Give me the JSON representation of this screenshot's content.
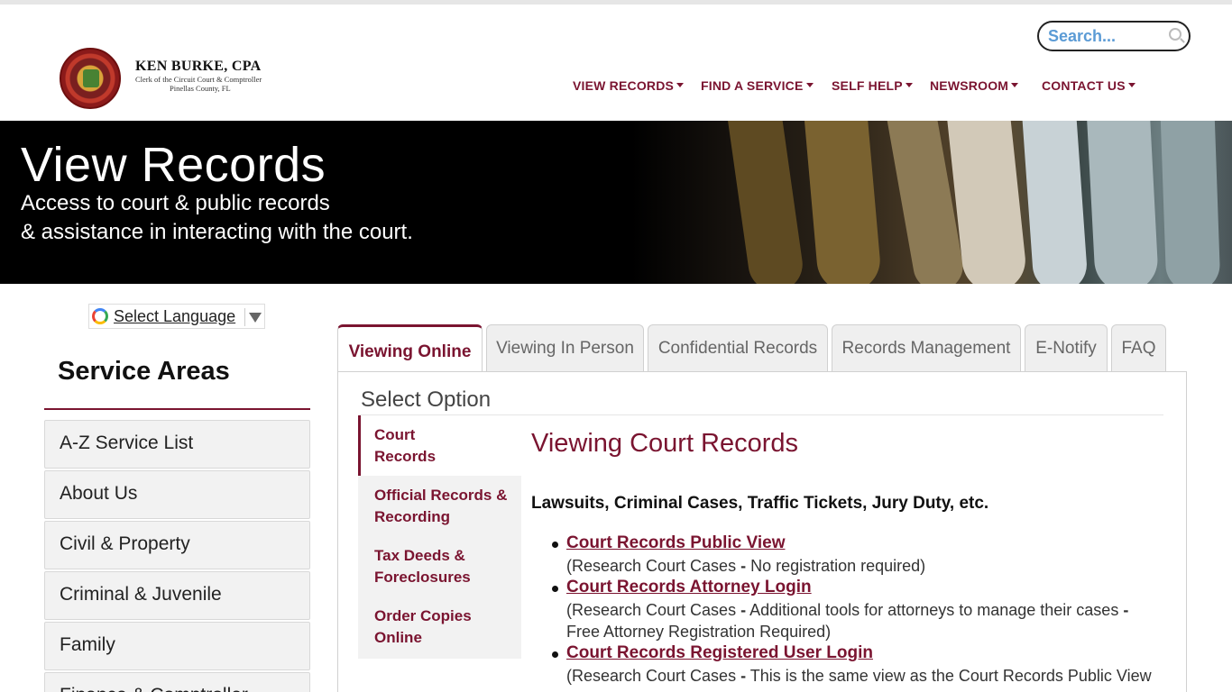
{
  "header": {
    "brand_name": "KEN BURKE, CPA",
    "brand_line1": "Clerk of the Circuit Court & Comptroller",
    "brand_line2": "Pinellas County, FL",
    "search_placeholder": "Search..."
  },
  "nav": {
    "items": [
      "VIEW RECORDS",
      "FIND A SERVICE",
      "SELF HELP",
      "NEWSROOM",
      "CONTACT US"
    ]
  },
  "hero": {
    "title": "View Records",
    "line1": "Access to court & public records",
    "line2": "& assistance in interacting with the court."
  },
  "sidebar": {
    "language_label": "Select Language",
    "title": "Service Areas",
    "items": [
      "A-Z Service List",
      "About Us",
      "Civil & Property",
      "Criminal & Juvenile",
      "Family",
      "Finance & Comptroller"
    ]
  },
  "tabs": [
    "Viewing Online",
    "Viewing In Person",
    "Confidential Records",
    "Records Management",
    "E-Notify",
    "FAQ"
  ],
  "panel": {
    "heading": "Select Option",
    "subnav": [
      {
        "line1": "Court",
        "line2": "Records"
      },
      {
        "line1": "Official Records &",
        "line2": "Recording"
      },
      {
        "line1": "Tax Deeds &",
        "line2": "Foreclosures"
      },
      {
        "line1": "Order Copies",
        "line2": "Online"
      }
    ],
    "title": "Viewing Court Records",
    "subtitle": "Lawsuits, Criminal Cases, Traffic Tickets, Jury Duty, etc.",
    "records": [
      {
        "link": "Court Records Public View",
        "desc_a": "(Research Court Cases ",
        "desc_sep": "-",
        "desc_b": " No registration required)",
        "desc_line2": ""
      },
      {
        "link": "Court Records Attorney Login",
        "desc_a": "(Research Court Cases ",
        "desc_sep": "-",
        "desc_b": " Additional tools for attorneys to manage their cases ",
        "desc_sep2": "-",
        "desc_line2": "Free Attorney Registration Required)"
      },
      {
        "link": "Court Records Registered User Login",
        "desc_a": "(Research Court Cases ",
        "desc_sep": "-",
        "desc_b": " This is the same view as the Court Records Public View",
        "desc_line2": ""
      }
    ]
  },
  "colors": {
    "accent": "#7a1430",
    "search_text": "#5b9bd5"
  }
}
